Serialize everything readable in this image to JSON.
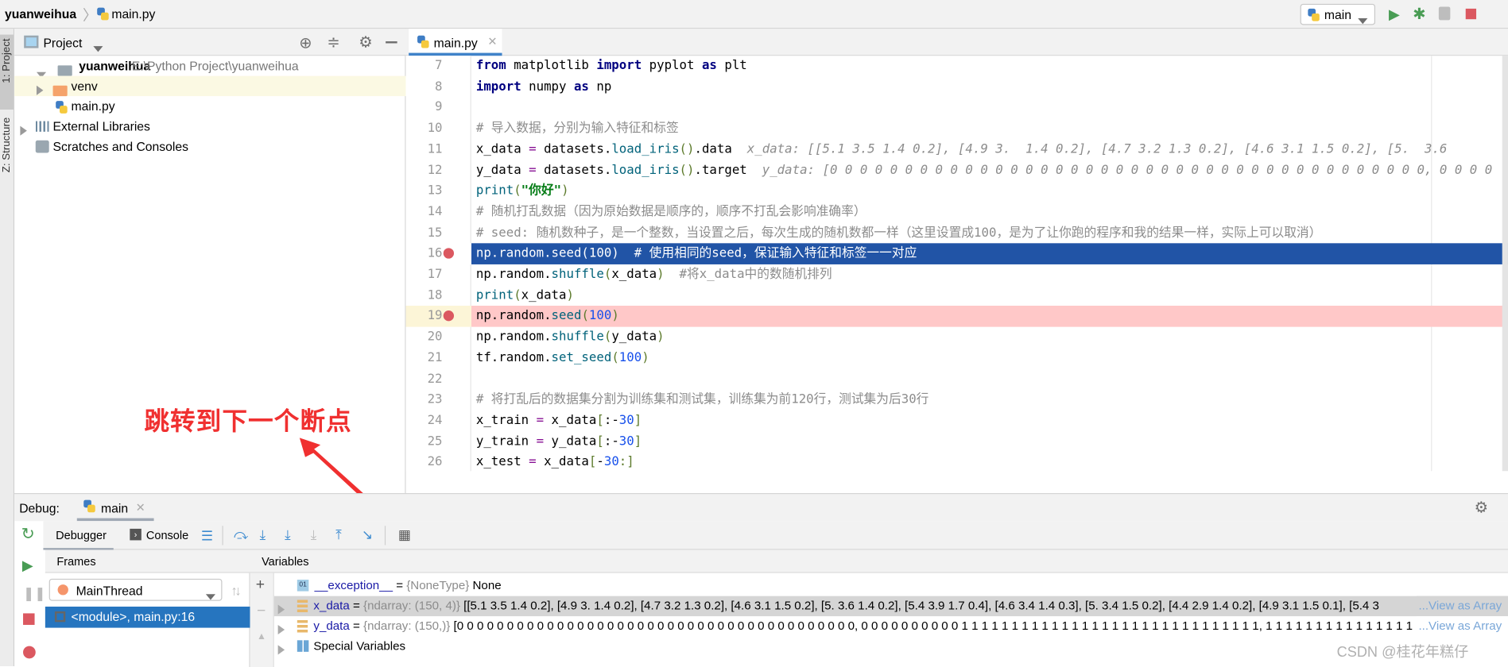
{
  "navbar": {
    "project": "yuanweihua",
    "file": "main.py",
    "run_config": "main",
    "icons": [
      "run-icon",
      "debug-icon",
      "coverage-icon",
      "stop-icon"
    ]
  },
  "tool_stripe": {
    "project_tab": "1: Project",
    "structure_tab": "Z: Structure"
  },
  "project_pane": {
    "title": "Project",
    "tree": [
      {
        "label": "yuanweihua",
        "path": "E:\\Python Project\\yuanweihua"
      },
      {
        "label": "venv"
      },
      {
        "label": "main.py"
      },
      {
        "label": "External Libraries"
      },
      {
        "label": "Scratches and Consoles"
      }
    ]
  },
  "editor": {
    "tab": "main.py",
    "lines": [
      {
        "num": "7",
        "tokens": [
          {
            "t": "from",
            "c": "kw"
          },
          {
            "t": " matplotlib ",
            "c": "tx"
          },
          {
            "t": "import",
            "c": "kw"
          },
          {
            "t": " pyplot ",
            "c": "tx"
          },
          {
            "t": "as",
            "c": "kw"
          },
          {
            "t": " plt",
            "c": "tx"
          }
        ]
      },
      {
        "num": "8",
        "tokens": [
          {
            "t": "import",
            "c": "kw"
          },
          {
            "t": " numpy ",
            "c": "tx"
          },
          {
            "t": "as",
            "c": "kw"
          },
          {
            "t": " np",
            "c": "tx"
          }
        ]
      },
      {
        "num": "9",
        "tokens": []
      },
      {
        "num": "10",
        "tokens": [
          {
            "t": "# 导入数据，分别为输入特征和标签",
            "c": "cm"
          }
        ]
      },
      {
        "num": "11",
        "tokens": [
          {
            "t": "x_data ",
            "c": "tx"
          },
          {
            "t": "=",
            "c": "op"
          },
          {
            "t": " datasets.",
            "c": "tx"
          },
          {
            "t": "load_iris",
            "c": "fn"
          },
          {
            "t": "()",
            "c": "par"
          },
          {
            "t": ".data  ",
            "c": "tx"
          },
          {
            "t": "x_data: [[5.1 3.5 1.4 0.2], [4.9 3.  1.4 0.2], [4.7 3.2 1.3 0.2], [4.6 3.1 1.5 0.2], [5.  3.6",
            "c": "hint"
          }
        ]
      },
      {
        "num": "12",
        "tokens": [
          {
            "t": "y_data ",
            "c": "tx"
          },
          {
            "t": "=",
            "c": "op"
          },
          {
            "t": " datasets.",
            "c": "tx"
          },
          {
            "t": "load_iris",
            "c": "fn"
          },
          {
            "t": "()",
            "c": "par"
          },
          {
            "t": ".target  ",
            "c": "tx"
          },
          {
            "t": "y_data: [0 0 0 0 0 0 0 0 0 0 0 0 0 0 0 0 0 0 0 0 0 0 0 0 0 0 0 0 0 0 0 0 0 0 0 0 0 0 0 0, 0 0 0 0",
            "c": "hint"
          }
        ]
      },
      {
        "num": "13",
        "tokens": [
          {
            "t": "print",
            "c": "fn"
          },
          {
            "t": "(",
            "c": "par"
          },
          {
            "t": "\"你好\"",
            "c": "str"
          },
          {
            "t": ")",
            "c": "par"
          }
        ]
      },
      {
        "num": "14",
        "tokens": [
          {
            "t": "# 随机打乱数据（因为原始数据是顺序的，顺序不打乱会影响准确率）",
            "c": "cm"
          }
        ]
      },
      {
        "num": "15",
        "tokens": [
          {
            "t": "# seed: 随机数种子，是一个整数，当设置之后，每次生成的随机数都一样（这里设置成100，是为了让你跑的程序和我的结果一样，实际上可以取消）",
            "c": "cm"
          }
        ]
      },
      {
        "num": "16",
        "breakpoint": true,
        "tokens": [
          {
            "t": "np.random.seed(100)  # 使用相同的seed，保证输入特征和标签一一对应",
            "c": "tx"
          }
        ]
      },
      {
        "num": "17",
        "tokens": [
          {
            "t": "np.random.",
            "c": "tx"
          },
          {
            "t": "shuffle",
            "c": "fn"
          },
          {
            "t": "(",
            "c": "par"
          },
          {
            "t": "x_data",
            "c": "tx"
          },
          {
            "t": ")",
            "c": "par"
          },
          {
            "t": "  #将x_data中的数随机排列",
            "c": "cm"
          }
        ]
      },
      {
        "num": "18",
        "tokens": [
          {
            "t": "print",
            "c": "fn"
          },
          {
            "t": "(",
            "c": "par"
          },
          {
            "t": "x_data",
            "c": "tx"
          },
          {
            "t": ")",
            "c": "par"
          }
        ]
      },
      {
        "num": "19",
        "breakpoint": true,
        "tokens": [
          {
            "t": "np.random.",
            "c": "tx"
          },
          {
            "t": "seed",
            "c": "fn"
          },
          {
            "t": "(",
            "c": "par"
          },
          {
            "t": "100",
            "c": "num"
          },
          {
            "t": ")",
            "c": "par"
          }
        ]
      },
      {
        "num": "20",
        "tokens": [
          {
            "t": "np.random.",
            "c": "tx"
          },
          {
            "t": "shuffle",
            "c": "fn"
          },
          {
            "t": "(",
            "c": "par"
          },
          {
            "t": "y_data",
            "c": "tx"
          },
          {
            "t": ")",
            "c": "par"
          }
        ]
      },
      {
        "num": "21",
        "tokens": [
          {
            "t": "tf.random.",
            "c": "tx"
          },
          {
            "t": "set_seed",
            "c": "fn"
          },
          {
            "t": "(",
            "c": "par"
          },
          {
            "t": "100",
            "c": "num"
          },
          {
            "t": ")",
            "c": "par"
          }
        ]
      },
      {
        "num": "22",
        "tokens": []
      },
      {
        "num": "23",
        "tokens": [
          {
            "t": "# 将打乱后的数据集分割为训练集和测试集，训练集为前120行，测试集为后30行",
            "c": "cm"
          }
        ]
      },
      {
        "num": "24",
        "tokens": [
          {
            "t": "x_train ",
            "c": "tx"
          },
          {
            "t": "=",
            "c": "op"
          },
          {
            "t": " x_data",
            "c": "tx"
          },
          {
            "t": "[",
            "c": "par"
          },
          {
            "t": ":-",
            "c": "tx"
          },
          {
            "t": "30",
            "c": "num"
          },
          {
            "t": "]",
            "c": "par"
          }
        ]
      },
      {
        "num": "25",
        "tokens": [
          {
            "t": "y_train ",
            "c": "tx"
          },
          {
            "t": "=",
            "c": "op"
          },
          {
            "t": " y_data",
            "c": "tx"
          },
          {
            "t": "[",
            "c": "par"
          },
          {
            "t": ":-",
            "c": "tx"
          },
          {
            "t": "30",
            "c": "num"
          },
          {
            "t": "]",
            "c": "par"
          }
        ]
      },
      {
        "num": "26",
        "tokens": [
          {
            "t": "x_test ",
            "c": "tx"
          },
          {
            "t": "=",
            "c": "op"
          },
          {
            "t": " x_data",
            "c": "tx"
          },
          {
            "t": "[",
            "c": "par"
          },
          {
            "t": "-",
            "c": "tx"
          },
          {
            "t": "30",
            "c": "num"
          },
          {
            "t": ":]",
            "c": "par"
          }
        ]
      }
    ]
  },
  "debug": {
    "label": "Debug:",
    "session_tab": "main",
    "tabs": {
      "debugger": "Debugger",
      "console": "Console"
    },
    "frames": {
      "title": "Frames",
      "thread": "MainThread",
      "items": [
        "<module>, main.py:16"
      ]
    },
    "variables": {
      "title": "Variables",
      "items": [
        {
          "name": "__exception__",
          "eq": " = ",
          "type": "{NoneType} ",
          "value": "None"
        },
        {
          "name": "x_data",
          "eq": " = ",
          "type": "{ndarray: (150, 4)} ",
          "value": "[[5.1 3.5 1.4 0.2], [4.9 3.  1.4 0.2], [4.7 3.2 1.3 0.2], [4.6 3.1 1.5 0.2], [5.  3.6 1.4 0.2], [5.4 3.9 1.7 0.4], [4.6 3.4 1.4 0.3], [5.  3.4 1.5 0.2], [4.4 2.9 1.4 0.2], [4.9 3.1 1.5 0.1], [5.4 3",
          "link": "...View as Array"
        },
        {
          "name": "y_data",
          "eq": " = ",
          "type": "{ndarray: (150,)} ",
          "value": "[0 0 0 0 0 0 0 0 0 0 0 0 0 0 0 0 0 0 0 0 0 0 0 0 0 0 0 0 0 0 0 0 0 0 0 0 0 0 0 0, 0 0 0 0 0 0 0 0 0 0 1 1 1 1 1 1 1 1 1 1 1 1 1 1 1 1 1 1 1 1 1 1 1 1 1 1 1 1 1 1, 1 1 1 1 1 1 1 1 1 1 1 1 1 1 1 1 1 1 1 1",
          "link": "...View as Array"
        },
        {
          "name": "Special Variables"
        }
      ]
    }
  },
  "annotation": {
    "text": "跳转到下一个断点",
    "color": "#f03030"
  },
  "watermark": "CSDN @桂花年糕仔",
  "colors": {
    "current_line": "#2154a6",
    "breakpoint_line": "#ffc8c8",
    "breakpoint": "#db5860",
    "selection": "#2675bf"
  }
}
